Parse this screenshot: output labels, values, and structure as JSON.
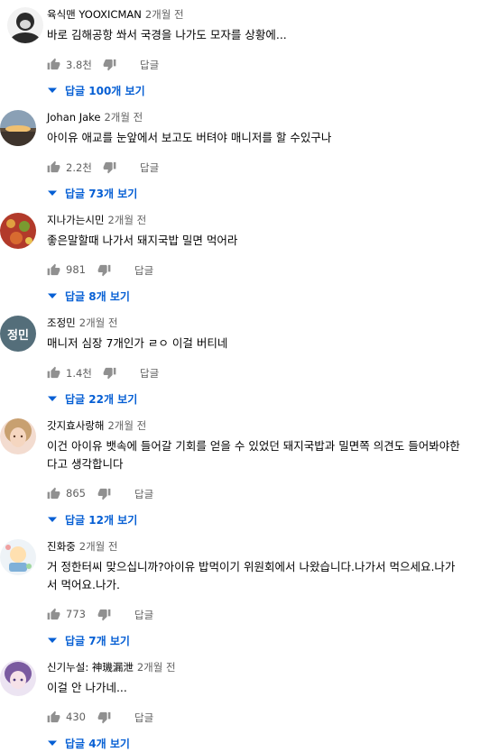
{
  "comments": [
    {
      "author": "육식맨 YOOXICMAN",
      "time": "2개월 전",
      "text_lines": [
        "바로 김해공항 쏴서 국경을 나가도 모자를 상황에..."
      ],
      "likes": "3.8천",
      "reply_label": "답글",
      "replies_label": "답글 100개 보기",
      "avatar_text": "",
      "avatar_color": "#2b2b2b"
    },
    {
      "author": "Johan Jake",
      "time": "2개월 전",
      "text_lines": [
        "아이유 애교를 눈앞에서 보고도 버텨야 매니저를 할 수있구나"
      ],
      "likes": "2.2천",
      "reply_label": "답글",
      "replies_label": "답글 73개 보기",
      "avatar_text": "",
      "avatar_color": "#c9a36a"
    },
    {
      "author": "지나가는시민",
      "time": "2개월 전",
      "text_lines": [
        "좋은말할때 나가서 돼지국밥 밀면 먹어라"
      ],
      "likes": "981",
      "reply_label": "답글",
      "replies_label": "답글 8개 보기",
      "avatar_text": "",
      "avatar_color": "#b23a2a"
    },
    {
      "author": "조정민",
      "time": "2개월 전",
      "text_lines": [
        "매니저 심장 7개인가 ㄹㅇ 이걸 버티네"
      ],
      "likes": "1.4천",
      "reply_label": "답글",
      "replies_label": "답글 22개 보기",
      "avatar_text": "정민",
      "avatar_color": "#546e7a"
    },
    {
      "author": "갓지효사랑해",
      "time": "2개월 전",
      "text_lines": [
        "이건 아이유 뱃속에 들어갈 기회를 얻을 수 있었던 돼지국밥과 밀면쪽 의견도 들어봐야한",
        "다고 생각합니다"
      ],
      "likes": "865",
      "reply_label": "답글",
      "replies_label": "답글 12개 보기",
      "avatar_text": "",
      "avatar_color": "#e8c2a8"
    },
    {
      "author": "진화중",
      "time": "2개월 전",
      "text_lines": [
        "거 정한터씨 맞으십니까?아이유 밥먹이기 위원회에서 나왔습니다.나가서 먹으세요.나가",
        "서 먹어요.나가."
      ],
      "likes": "773",
      "reply_label": "답글",
      "replies_label": "답글 7개 보기",
      "avatar_text": "",
      "avatar_color": "#eef3f7"
    },
    {
      "author": "신기누설: 神璣漏泄",
      "time": "2개월 전",
      "text_lines": [
        "이걸 안 나가네..."
      ],
      "likes": "430",
      "reply_label": "답글",
      "replies_label": "답글 4개 보기",
      "avatar_text": "",
      "avatar_color": "#c8b8d8"
    }
  ]
}
